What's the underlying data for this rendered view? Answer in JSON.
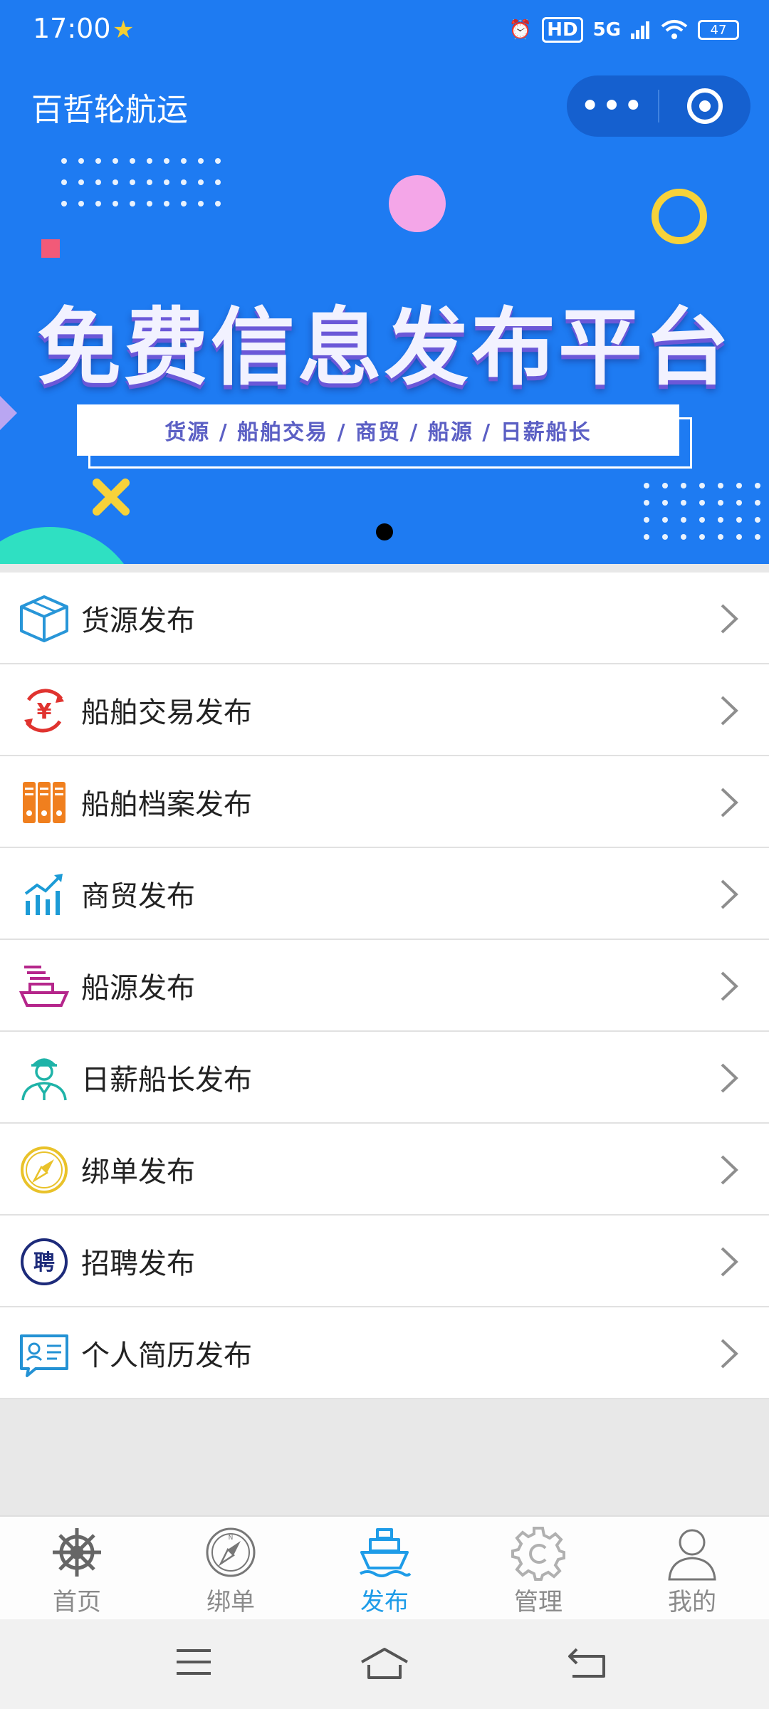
{
  "status_bar": {
    "time": "17:00",
    "network": "5G",
    "hd": "HD",
    "battery": "47"
  },
  "app": {
    "title": "百哲轮航运"
  },
  "banner": {
    "headline": "免费信息发布平台",
    "subline": "货源 / 船舶交易 / 商贸 / 船源 / 日薪船长",
    "colors": {
      "background": "#1e7bf2",
      "headline_shadow": "#6b58d8",
      "subline_text": "#5b5fc4"
    }
  },
  "menu": {
    "items": [
      {
        "label": "货源发布",
        "icon": "package-box-icon"
      },
      {
        "label": "船舶交易发布",
        "icon": "yuan-exchange-icon"
      },
      {
        "label": "船舶档案发布",
        "icon": "archive-binders-icon"
      },
      {
        "label": "商贸发布",
        "icon": "trade-chart-icon"
      },
      {
        "label": "船源发布",
        "icon": "cargo-ship-icon"
      },
      {
        "label": "日薪船长发布",
        "icon": "captain-icon"
      },
      {
        "label": "绑单发布",
        "icon": "compass-icon"
      },
      {
        "label": "招聘发布",
        "icon": "recruit-badge-icon",
        "badge_text": "聘"
      },
      {
        "label": "个人简历发布",
        "icon": "resume-card-icon"
      }
    ]
  },
  "tabbar": {
    "active_color": "#1e9ce8",
    "tabs": [
      {
        "label": "首页",
        "icon": "ship-wheel-icon"
      },
      {
        "label": "绑单",
        "icon": "compass-icon"
      },
      {
        "label": "发布",
        "icon": "ship-icon",
        "active": true
      },
      {
        "label": "管理",
        "icon": "gear-icon"
      },
      {
        "label": "我的",
        "icon": "user-icon"
      }
    ]
  }
}
